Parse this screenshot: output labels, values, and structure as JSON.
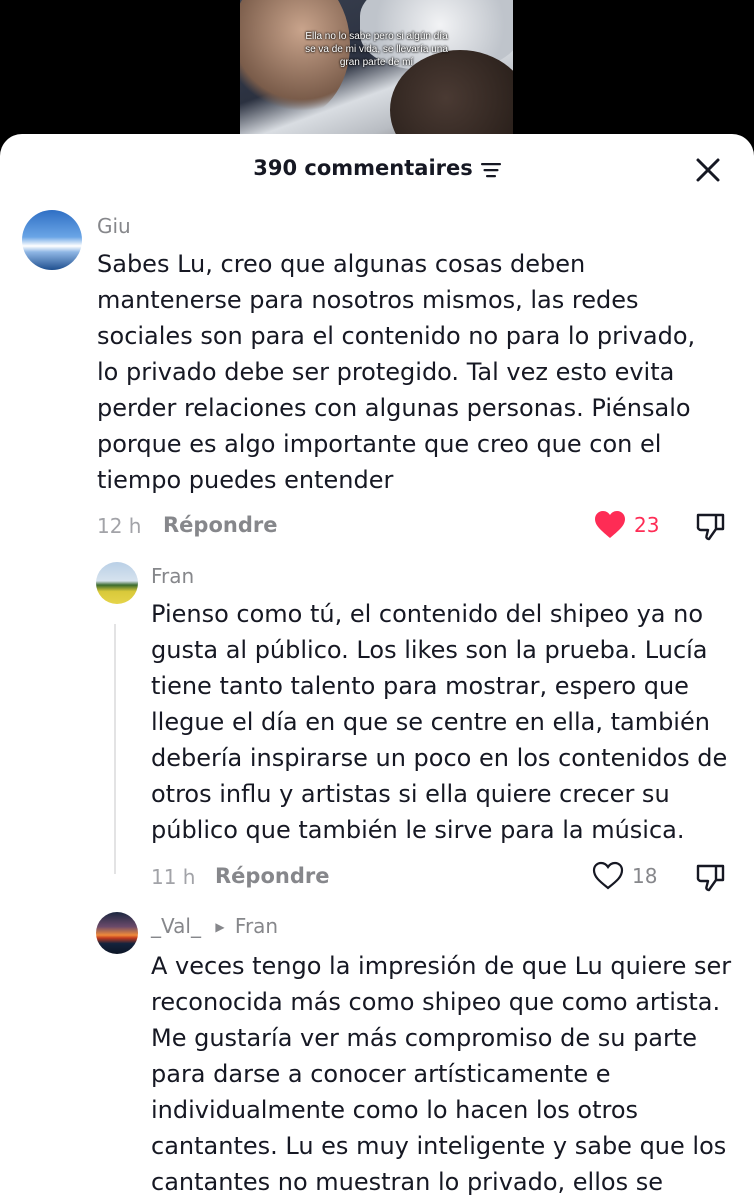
{
  "video": {
    "caption": "Ella no lo sabe pero si algún día se va de mi vida, se llevaría una gran parte de mí"
  },
  "header": {
    "title": "390 commentaires",
    "sort_icon": "sort-icon",
    "close_icon": "close-icon"
  },
  "comments": [
    {
      "username": "Giu",
      "text": "Sabes Lu, creo que algunas cosas deben mantenerse para nosotros mismos, las redes sociales son para el contenido no para lo privado, lo privado debe ser protegido. Tal vez esto evita perder relaciones con algunas personas. Piénsalo porque es algo importante que creo que con el tiempo puedes entender",
      "time": "12 h",
      "reply_label": "Répondre",
      "likes": "23",
      "liked": true
    },
    {
      "username": "Fran",
      "text": "Pienso como tú, el contenido del shipeo ya no gusta al público. Los likes son la prueba. Lucía tiene tanto talento para mostrar, espero que llegue el día en que se centre en ella, también debería inspirarse un poco en los contenidos de otros influ y artistas si ella quiere crecer su público que también le sirve para la música.",
      "time": "11 h",
      "reply_label": "Répondre",
      "likes": "18",
      "liked": false
    },
    {
      "username": "_Val_",
      "reply_to": "Fran",
      "text": "A veces tengo la impresión de que Lu quiere ser reconocida más como shipeo que como artista. Me gustaría ver más compromiso de su parte para darse a conocer artísticamente e individualmente como lo hacen los otros cantantes. Lu es muy inteligente y sabe que los cantantes no muestran lo privado, ellos se"
    }
  ],
  "colors": {
    "like_active": "#fe2c55",
    "text_primary": "#161823",
    "text_secondary": "#86878b"
  }
}
